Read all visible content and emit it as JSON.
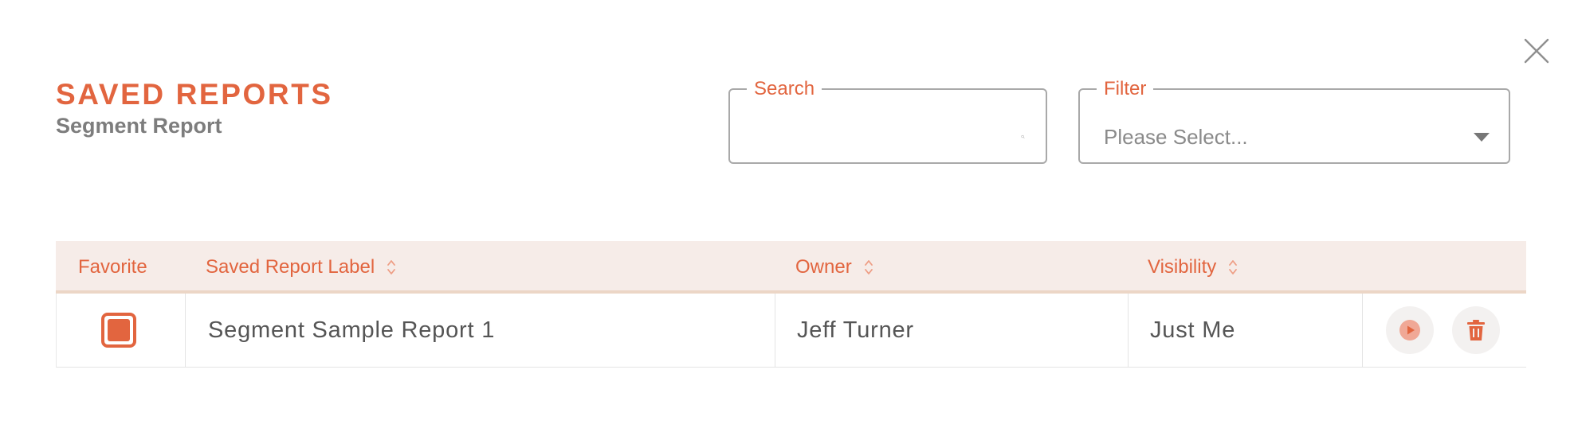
{
  "header": {
    "title": "SAVED REPORTS",
    "subtitle": "Segment Report"
  },
  "search": {
    "label": "Search",
    "value": "",
    "icon": "search-icon"
  },
  "filter": {
    "label": "Filter",
    "selected": "Please Select...",
    "icon": "caret-down-icon"
  },
  "close": {
    "icon": "close-icon"
  },
  "table": {
    "columns": {
      "favorite": "Favorite",
      "label": "Saved Report Label",
      "owner": "Owner",
      "visibility": "Visibility"
    },
    "rows": [
      {
        "favorite": true,
        "label": "Segment Sample Report 1",
        "owner": "Jeff Turner",
        "visibility": "Just Me",
        "actions": [
          "play-icon",
          "trash-icon"
        ]
      }
    ]
  },
  "colors": {
    "accent": "#e2653f",
    "header_bg": "#f6ece8",
    "subtitle": "#7d7d7d",
    "body_text": "#555555",
    "action_bg": "#f3f1f0",
    "play_icon_bg": "#f0a896"
  }
}
